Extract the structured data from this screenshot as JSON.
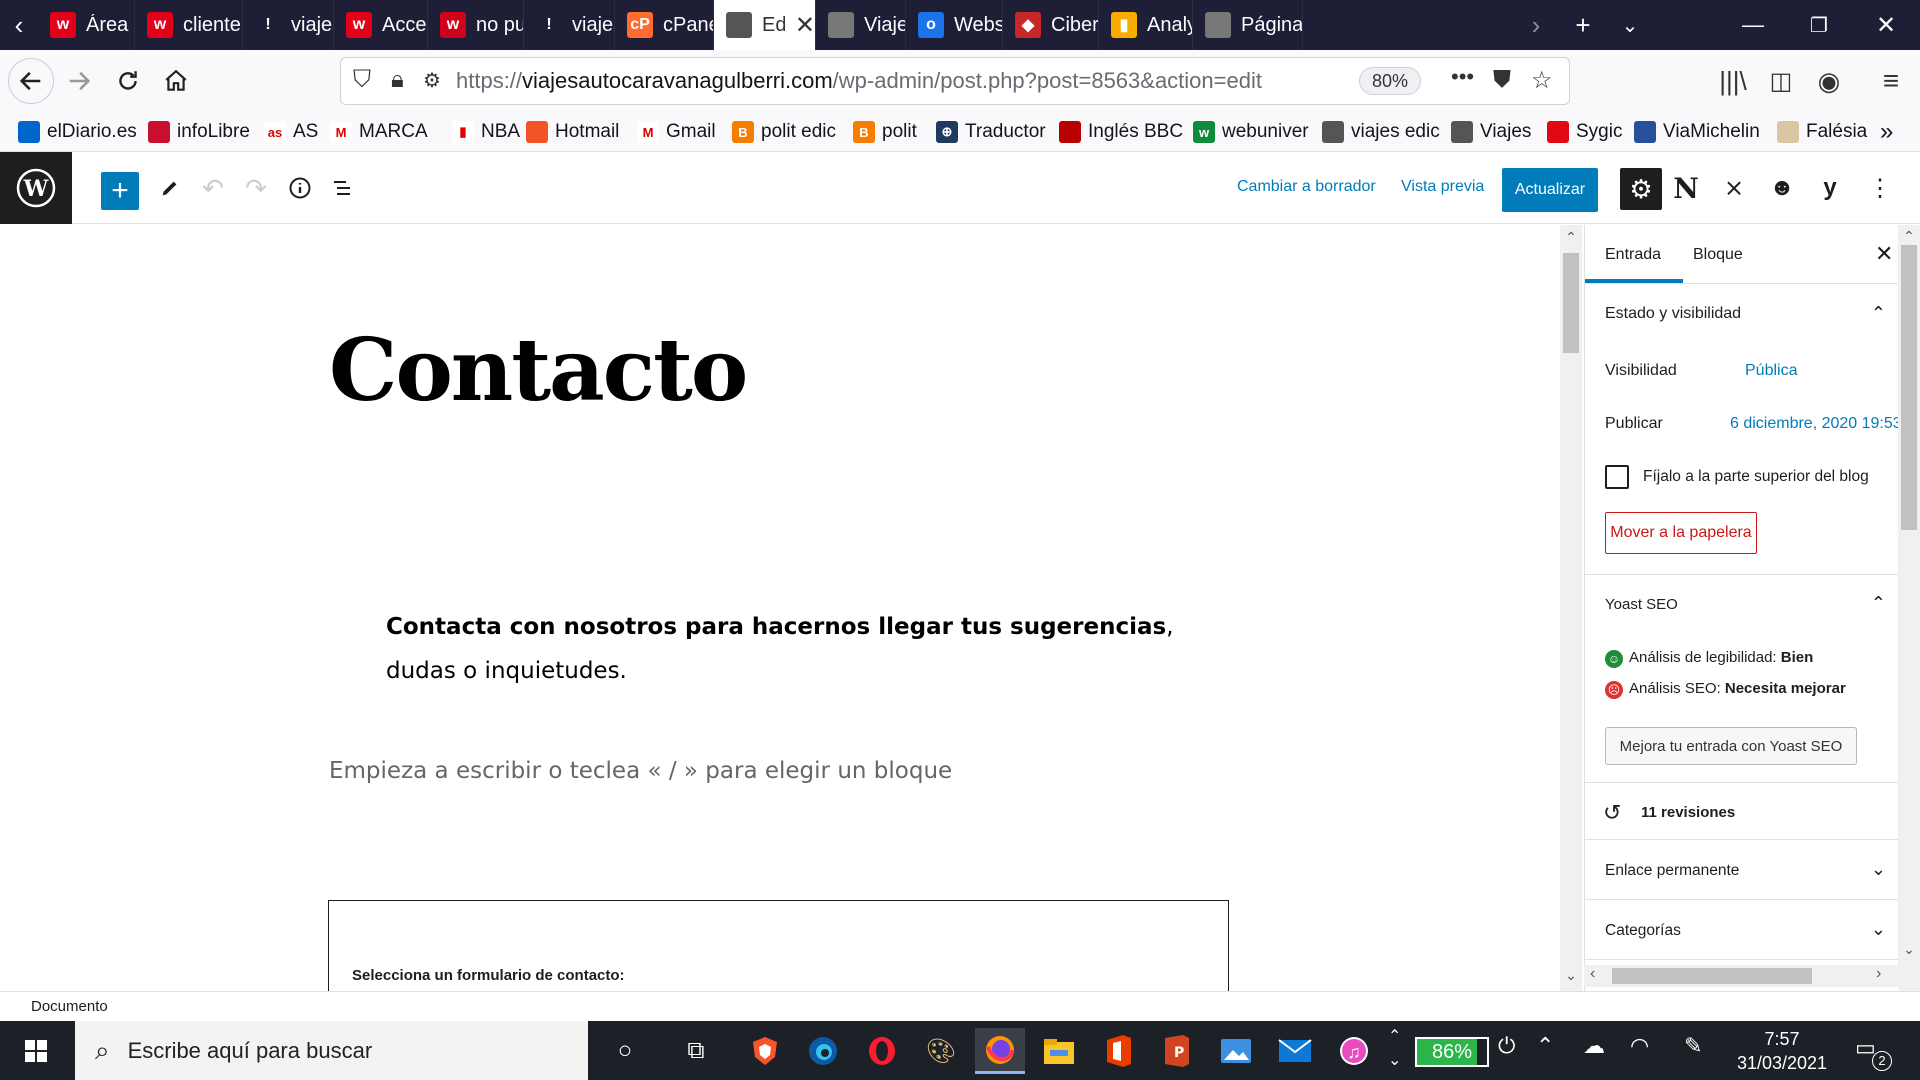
{
  "browser": {
    "tabs": [
      {
        "label": "Área C",
        "fav_text": "w",
        "fav_color": "#e3001b"
      },
      {
        "label": "cliente",
        "fav_text": "w",
        "fav_color": "#e3001b"
      },
      {
        "label": "viajesa",
        "fav_text": "!",
        "fav_color": "#1f1e37"
      },
      {
        "label": "Acceso",
        "fav_text": "w",
        "fav_color": "#e3001b"
      },
      {
        "label": "no pue",
        "fav_text": "w",
        "fav_color": "#d0021b"
      },
      {
        "label": "viajesa",
        "fav_text": "!",
        "fav_color": "#1f1e37"
      },
      {
        "label": "cPanel",
        "fav_text": "cP",
        "fav_color": "#ff6c2c"
      },
      {
        "label": "Edi",
        "fav_text": "",
        "fav_color": "#555555"
      },
      {
        "label": "Viaje P",
        "fav_text": "",
        "fav_color": "#777777"
      },
      {
        "label": "Websit",
        "fav_text": "o",
        "fav_color": "#1a73e8"
      },
      {
        "label": "CiberP",
        "fav_text": "◆",
        "fav_color": "#c62828"
      },
      {
        "label": "Analyt",
        "fav_text": "▮",
        "fav_color": "#f9ab00"
      },
      {
        "label": "Página",
        "fav_text": "",
        "fav_color": "#777777"
      }
    ],
    "url": {
      "proto": "https://",
      "host": "viajesautocaravanagulberri.com",
      "path": "/wp-admin/post.php?post=8563&action=edit"
    },
    "zoom": "80%",
    "bookmarks": [
      {
        "label": "elDiario.es",
        "icon_color": "#0066cc",
        "icon_text": ""
      },
      {
        "label": "infoLibre",
        "icon_color": "#c8102e",
        "icon_text": ""
      },
      {
        "label": "AS",
        "icon_color": "#ffffff",
        "icon_text": "as"
      },
      {
        "label": "MARCA",
        "icon_color": "#ffffff",
        "icon_text": "M"
      },
      {
        "label": "NBA",
        "icon_color": "#ffffff",
        "icon_text": "▮"
      },
      {
        "label": "Hotmail",
        "icon_color": "#f35325",
        "icon_text": ""
      },
      {
        "label": "Gmail",
        "icon_color": "#ffffff",
        "icon_text": "M"
      },
      {
        "label": "polit edic",
        "icon_color": "#f57d00",
        "icon_text": "B"
      },
      {
        "label": "polit",
        "icon_color": "#f57d00",
        "icon_text": "B"
      },
      {
        "label": "Traductor",
        "icon_color": "#1e3a5f",
        "icon_text": "⊕"
      },
      {
        "label": "Inglés BBC",
        "icon_color": "#b80000",
        "icon_text": ""
      },
      {
        "label": "webuniver",
        "icon_color": "#0f8b3c",
        "icon_text": "w"
      },
      {
        "label": "viajes edic",
        "icon_color": "#555555",
        "icon_text": ""
      },
      {
        "label": "Viajes",
        "icon_color": "#555555",
        "icon_text": ""
      },
      {
        "label": "Sygic",
        "icon_color": "#e30613",
        "icon_text": ""
      },
      {
        "label": "ViaMichelin",
        "icon_color": "#27509b",
        "icon_text": ""
      },
      {
        "label": "Falésia",
        "icon_color": "#d9c7a4",
        "icon_text": ""
      }
    ]
  },
  "editor": {
    "header": {
      "switch_draft": "Cambiar a borrador",
      "preview": "Vista previa",
      "update": "Actualizar"
    },
    "post_title": "Contacto",
    "paragraph_bold": "Contacta con nosotros para hacernos llegar tus sugerencias",
    "paragraph_rest": ", dudas o inquietudes.",
    "block_placeholder": "Empieza a escribir o teclea « / » para elegir un bloque",
    "cf7_label": "Selecciona un formulario de contacto:"
  },
  "sidebar": {
    "tabs": [
      "Entrada",
      "Bloque"
    ],
    "status_title": "Estado y visibilidad",
    "visibility_label": "Visibilidad",
    "visibility_value": "Pública",
    "publish_label": "Publicar",
    "publish_value": "6 diciembre, 2020 19:53",
    "sticky_label": "Fíjalo a la parte superior del blog",
    "trash": "Mover a la papelera",
    "yoast_title": "Yoast SEO",
    "readability_label": "Análisis de legibilidad:",
    "readability_value": "Bien",
    "seo_label": "Análisis SEO:",
    "seo_value": "Necesita mejorar",
    "yoast_button": "Mejora tu entrada con Yoast SEO",
    "revisions": "11 revisiones",
    "permalink": "Enlace permanente",
    "categories": "Categorías",
    "status_good_color": "#1e8c3a",
    "status_bad_color": "#dc3232"
  },
  "footer": {
    "breadcrumb": "Documento"
  },
  "taskbar": {
    "search_placeholder": "Escribe aquí para buscar",
    "battery": "86%",
    "battery_level": 0.86,
    "time": "7:57",
    "date": "31/03/2021",
    "notifications": "2"
  }
}
